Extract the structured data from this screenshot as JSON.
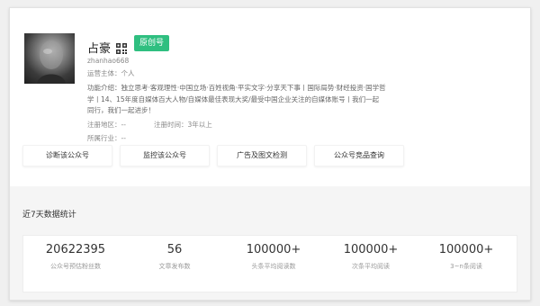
{
  "profile": {
    "name": "占豪",
    "badge": "原创号",
    "account_id": "zhanhao668",
    "owner": "运营主体：个人",
    "description_lines": [
      "功能介绍：独立思考·客观理性·中国立场·百姓视角·平实文字·分享天下事丨国际局势·财经投资·国学哲",
      "学丨14、15年度自媒体百大人物/自媒体最佳表现大奖/最受中国企业关注的自媒体账号丨我们一起",
      "同行，我们一起进步！"
    ],
    "region": "注册地区：--",
    "reg_time": "注册时间：3年以上",
    "industry": "所属行业：--"
  },
  "actions": [
    "诊断该公众号",
    "监控该公众号",
    "广告及图文检测",
    "公众号竞品查询"
  ],
  "stats": {
    "title": "近7天数据统计",
    "items": [
      {
        "value": "20622395",
        "label": "公众号预估粉丝数"
      },
      {
        "value": "56",
        "label": "文章发布数"
      },
      {
        "value": "100000+",
        "label": "头条平均阅读数"
      },
      {
        "value": "100000+",
        "label": "次条平均阅读"
      },
      {
        "value": "100000+",
        "label": "3~n条阅读"
      }
    ]
  },
  "colors": {
    "badge": "#2fbf80"
  }
}
